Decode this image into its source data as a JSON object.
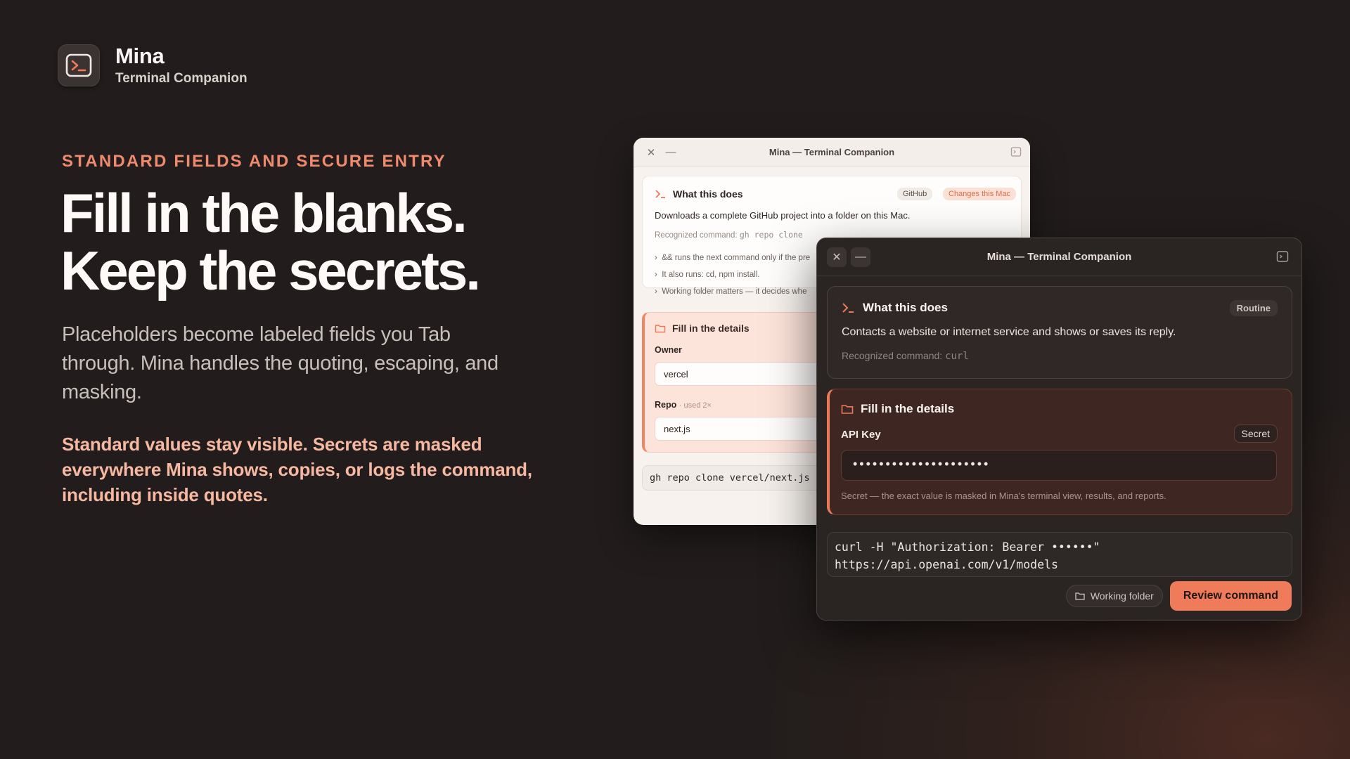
{
  "brand": {
    "name": "Mina",
    "subtitle": "Terminal Companion",
    "logo_icon": "terminal-prompt-icon"
  },
  "hero": {
    "eyebrow": "STANDARD FIELDS AND SECURE ENTRY",
    "headline_line1": "Fill in the blanks.",
    "headline_line2": "Keep the secrets.",
    "lede": "Placeholders become labeled fields you Tab through. Mina handles the quoting, escaping, and masking.",
    "emphasis": "Standard values stay visible. Secrets are masked everywhere Mina shows, copies, or logs the command, including inside quotes."
  },
  "back_window": {
    "title": "Mina — Terminal Companion",
    "what_header": "What this does",
    "badge_service": "GitHub",
    "badge_warning": "Changes this Mac",
    "description": "Downloads a complete GitHub project into a folder on this Mac.",
    "recognized_label": "Recognized command:",
    "recognized_cmd": "gh repo clone",
    "bullets": [
      "&& runs the next command only if the pre",
      "It also runs: cd, npm install.",
      "Working folder matters — it decides whe"
    ],
    "fill_header": "Fill in the details",
    "fields": [
      {
        "label": "Owner",
        "meta": "",
        "value": "vercel"
      },
      {
        "label": "Repo",
        "meta": "· used 2×",
        "value": "next.js"
      }
    ],
    "command": "gh repo clone vercel/next.js"
  },
  "front_window": {
    "title": "Mina — Terminal Companion",
    "what_header": "What this does",
    "badge": "Routine",
    "description": "Contacts a website or internet service and shows or saves its reply.",
    "recognized_label": "Recognized command:",
    "recognized_cmd": "curl",
    "fill_header": "Fill in the details",
    "field_label": "API Key",
    "field_badge": "Secret",
    "masked_value": "•••••••••••••••••••••",
    "hint": "Secret — the exact value is masked in Mina's terminal view, results, and reports.",
    "command_line1": "curl -H \"Authorization: Bearer ••••••\"",
    "command_line2": "https://api.openai.com/v1/models",
    "folder_button": "Working folder",
    "review_button": "Review command"
  },
  "colors": {
    "accent": "#ef7b5a",
    "eyebrow": "#f08a6c",
    "emphasis": "#f7b8a2",
    "background": "#221d1c"
  }
}
